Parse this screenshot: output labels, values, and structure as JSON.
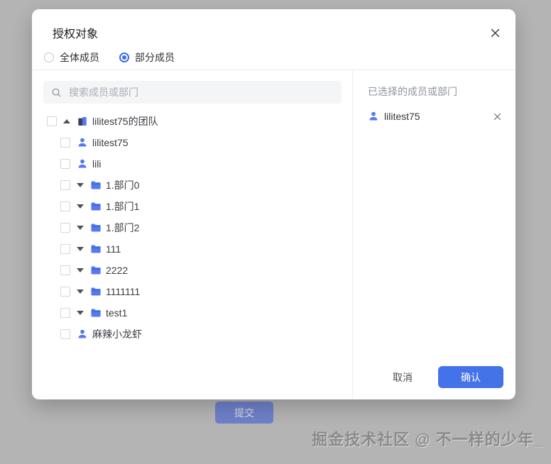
{
  "colors": {
    "overlay_background": "#b4b4b4",
    "accent_blue": "#3b6ce8",
    "confirm_blue": "#4472e8",
    "icon_blue": "#547af2",
    "team_icon_navy": "#39405e",
    "muted_submit_blue": "#6f80c9"
  },
  "underlay": {
    "submit_label": "提交",
    "watermark": "掘金技术社区 @ 不一样的少年_"
  },
  "dialog": {
    "title": "授权对象",
    "radio_options": [
      {
        "label": "全体成员",
        "selected": false
      },
      {
        "label": "部分成员",
        "selected": true
      }
    ],
    "search": {
      "placeholder": "搜索成员或部门",
      "icon": "search-icon",
      "value": ""
    },
    "tree": {
      "items": [
        {
          "label": "lilitest75的团队",
          "icon": "team-icon",
          "arrow": "up",
          "indent": 0,
          "checked": false
        },
        {
          "label": "lilitest75",
          "icon": "user-icon",
          "arrow": null,
          "indent": 1,
          "checked": false
        },
        {
          "label": "lili",
          "icon": "user-icon",
          "arrow": null,
          "indent": 1,
          "checked": false
        },
        {
          "label": "1.部门0",
          "icon": "folder-icon",
          "arrow": "down",
          "indent": 1,
          "checked": false
        },
        {
          "label": "1.部门1",
          "icon": "folder-icon",
          "arrow": "down",
          "indent": 1,
          "checked": false
        },
        {
          "label": "1.部门2",
          "icon": "folder-icon",
          "arrow": "down",
          "indent": 1,
          "checked": false
        },
        {
          "label": "111",
          "icon": "folder-icon",
          "arrow": "down",
          "indent": 1,
          "checked": false
        },
        {
          "label": "2222",
          "icon": "folder-icon",
          "arrow": "down",
          "indent": 1,
          "checked": false
        },
        {
          "label": "1111111",
          "icon": "folder-icon",
          "arrow": "down",
          "indent": 1,
          "checked": false
        },
        {
          "label": "test1",
          "icon": "folder-icon",
          "arrow": "down",
          "indent": 1,
          "checked": false
        },
        {
          "label": "麻辣小龙虾",
          "icon": "user-icon",
          "arrow": null,
          "indent": 1,
          "checked": false
        }
      ]
    },
    "selected_panel": {
      "header": "已选择的成员或部门",
      "items": [
        {
          "label": "lilitest75",
          "icon": "user-icon"
        }
      ]
    },
    "footer": {
      "cancel_label": "取消",
      "confirm_label": "确认"
    }
  }
}
